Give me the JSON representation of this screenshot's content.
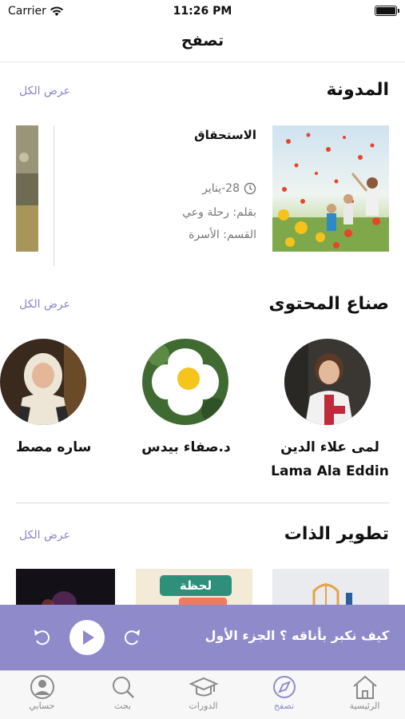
{
  "status": {
    "carrier": "Carrier",
    "time": "11:26 PM"
  },
  "nav": {
    "title": "تصفح"
  },
  "blog": {
    "section_title": "المدونة",
    "view_all": "عرض الكل",
    "post": {
      "title": "الاستحقاق",
      "date": "28-يناير",
      "author": "بقلم: رحلة وعي",
      "category": "القسم: الأسرة"
    }
  },
  "creators": {
    "section_title": "صناع المحتوى",
    "view_all": "عرض الكل",
    "items": [
      {
        "name": "لمى علاء الدين",
        "name_en": "Lama Ala Eddin"
      },
      {
        "name": "د.صفاء بيدس"
      },
      {
        "name": "ساره مصط"
      }
    ]
  },
  "self_dev": {
    "section_title": "تطوير الذات",
    "view_all": "عرض الكل",
    "card_text": "لحظة"
  },
  "player": {
    "title": "كيف نكبر بأناقه ؟ الجزء الأول"
  },
  "tabs": [
    {
      "label": "الرئيسية",
      "icon": "home-icon"
    },
    {
      "label": "تصفح",
      "icon": "compass-icon",
      "active": true
    },
    {
      "label": "الدورات",
      "icon": "graduation-cap-icon"
    },
    {
      "label": "بحث",
      "icon": "search-icon"
    },
    {
      "label": "حسابي",
      "icon": "user-circle-icon"
    }
  ],
  "colors": {
    "accent": "#8f8bcb",
    "link": "#8a85c9"
  }
}
